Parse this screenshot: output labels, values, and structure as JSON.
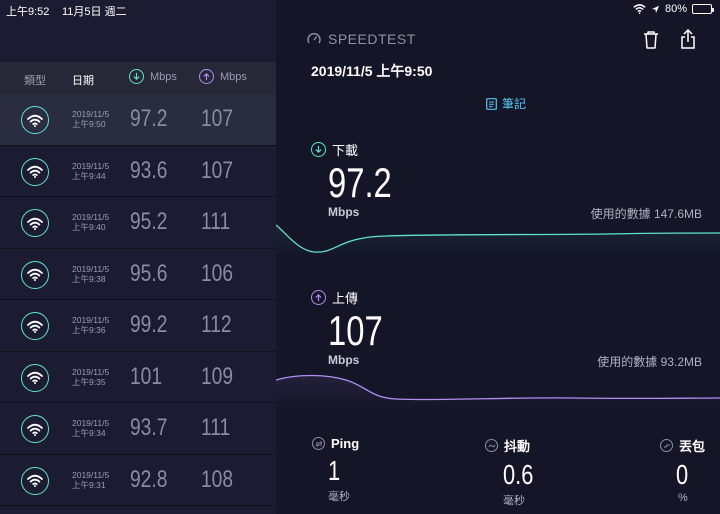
{
  "status_bar": {
    "time": "上午9:52",
    "date": "11月5日 週二",
    "battery": "80%"
  },
  "list": {
    "headers": {
      "type": "類型",
      "date": "日期",
      "download_unit": "Mbps",
      "upload_unit": "Mbps"
    },
    "rows": [
      {
        "date": "2019/11/5",
        "time": "上午9:50",
        "download": "97.2",
        "upload": "107",
        "selected": true
      },
      {
        "date": "2019/11/5",
        "time": "上午9:44",
        "download": "93.6",
        "upload": "107",
        "selected": false
      },
      {
        "date": "2019/11/5",
        "time": "上午9:40",
        "download": "95.2",
        "upload": "111",
        "selected": false
      },
      {
        "date": "2019/11/5",
        "time": "上午9:38",
        "download": "95.6",
        "upload": "106",
        "selected": false
      },
      {
        "date": "2019/11/5",
        "time": "上午9:36",
        "download": "99.2",
        "upload": "112",
        "selected": false
      },
      {
        "date": "2019/11/5",
        "time": "上午9:35",
        "download": "101",
        "upload": "109",
        "selected": false
      },
      {
        "date": "2019/11/5",
        "time": "上午9:34",
        "download": "93.7",
        "upload": "111",
        "selected": false
      },
      {
        "date": "2019/11/5",
        "time": "上午9:31",
        "download": "92.8",
        "upload": "108",
        "selected": false
      }
    ]
  },
  "detail": {
    "brand": "SPEEDTEST",
    "result_datetime": "2019/11/5 上午9:50",
    "notes_label": "筆記",
    "download": {
      "label": "下載",
      "value": "97.2",
      "unit": "Mbps",
      "data_used": "使用的數據 147.6MB"
    },
    "upload": {
      "label": "上傳",
      "value": "107",
      "unit": "Mbps",
      "data_used": "使用的數據 93.2MB"
    },
    "ping": {
      "label": "Ping",
      "value": "1",
      "unit": "毫秒"
    },
    "jitter": {
      "label": "抖動",
      "value": "0.6",
      "unit": "毫秒"
    },
    "loss": {
      "label": "丟包",
      "value": "0",
      "unit": "%"
    }
  },
  "colors": {
    "download_accent": "#5fe3cf",
    "upload_accent": "#b58cf3",
    "notes_accent": "#58c8f0"
  }
}
